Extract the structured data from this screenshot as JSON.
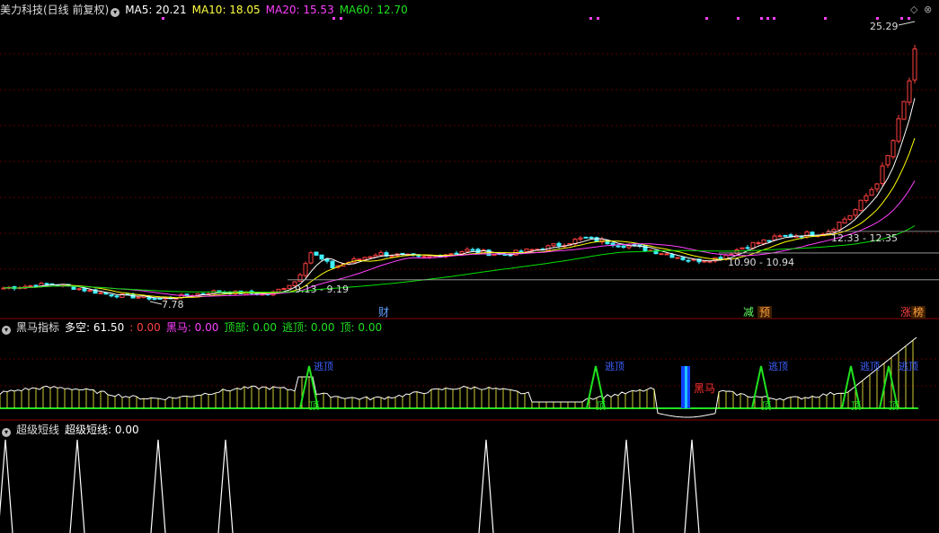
{
  "main_header": {
    "title": "美力科技(日线 前复权)",
    "ma5": "MA5: 20.21",
    "ma10": "MA10: 18.05",
    "ma20": "MA20: 15.53",
    "ma60": "MA60: 12.70"
  },
  "price_annotations": {
    "high": "25.29",
    "low": "7.78",
    "range1": "9.13 - 9.19",
    "range2": "10.90 - 10.94",
    "range3": "12.33 - 12.35"
  },
  "event_tags": {
    "cai": "财",
    "jian": "减",
    "yu": "预",
    "zhang": "涨",
    "bang": "榜"
  },
  "indicator_header": {
    "name": "黑马指标",
    "duokong": "多空: 61.50",
    "zero": ": 0.00",
    "heima": "黑马: 0.00",
    "dingbu": "顶部: 0.00",
    "taoding": "逃顶: 0.00",
    "ding": "顶: 0.00"
  },
  "indicator_labels": {
    "taoding": "逃顶",
    "ding": "顶",
    "heima": "黑马"
  },
  "short_header": {
    "name": "超级短线",
    "value": "超级短线: 0.00"
  },
  "colors": {
    "up": "#ff4040",
    "down": "#40f0ff",
    "ma5": "#ffffff",
    "ma10": "#ffff00",
    "ma20": "#ff40ff",
    "ma60": "#00e000",
    "divider": "#8b0000"
  },
  "chart_data": [
    {
      "type": "candlestick",
      "title": "美力科技(日线 前复权)",
      "series": [
        {
          "name": "MA5",
          "last": 20.21
        },
        {
          "name": "MA10",
          "last": 18.05
        },
        {
          "name": "MA20",
          "last": 15.53
        },
        {
          "name": "MA60",
          "last": 12.7
        }
      ],
      "high_marker": 25.29,
      "low_marker": 7.78,
      "range_labels": [
        "9.13 - 9.19",
        "10.90 - 10.94",
        "12.33 - 12.35"
      ],
      "horizontal_levels": [
        9.16,
        10.92,
        12.34
      ]
    },
    {
      "type": "line",
      "title": "黑马指标",
      "values": {
        "多空": 61.5,
        "黑马": 0.0,
        "顶部": 0.0,
        "逃顶": 0.0,
        "顶": 0.0
      }
    },
    {
      "type": "line",
      "title": "超级短线",
      "values": {
        "超级短线": 0.0
      }
    }
  ]
}
